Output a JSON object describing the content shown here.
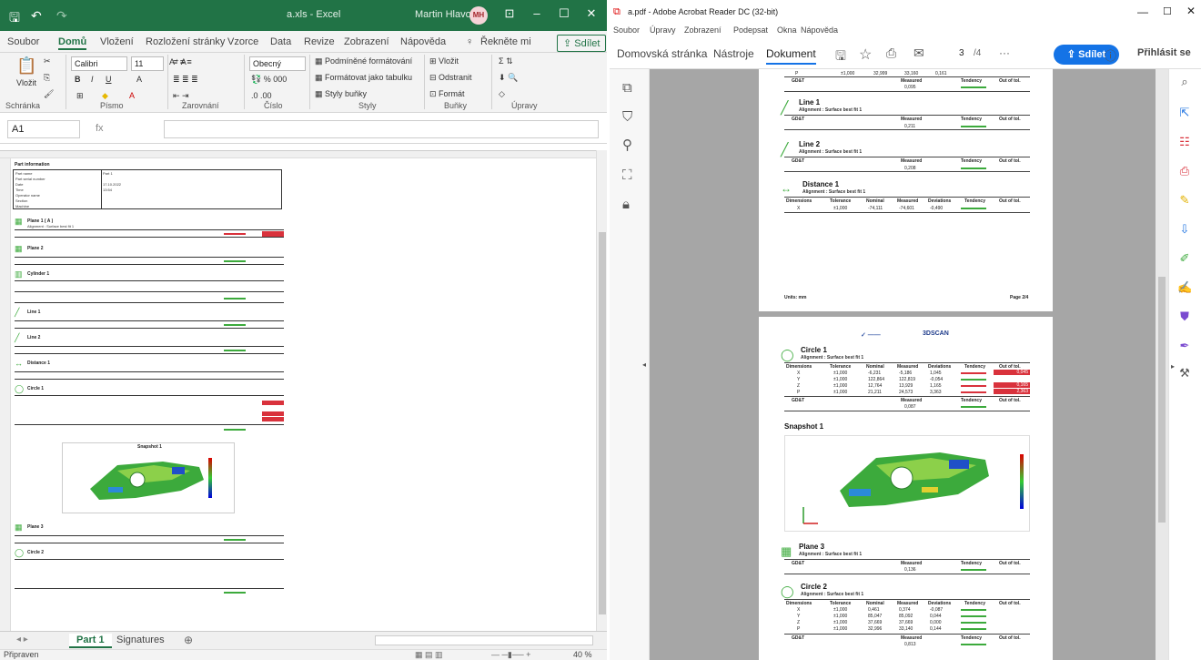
{
  "excel": {
    "file_title": "a.xls - Excel",
    "user_name": "Martin Hlavoň",
    "user_initials": "MH",
    "menu_tabs": [
      "Soubor",
      "Domů",
      "Vložení",
      "Rozložení stránky",
      "Vzorce",
      "Data",
      "Revize",
      "Zobrazení",
      "Nápověda"
    ],
    "tell_me": "Řekněte mi",
    "share": "Sdílet",
    "ribbon": {
      "paste": "Vložit",
      "font_name": "Calibri",
      "font_size": "11",
      "number_format": "Obecný",
      "cond_format": "Podmíněné formátování",
      "format_table": "Formátovat jako tabulku",
      "cell_styles": "Styly buňky",
      "insert": "Vložit",
      "delete": "Odstranit",
      "format": "Formát",
      "groups": [
        "Schránka",
        "Písmo",
        "Zarovnání",
        "Číslo",
        "Styly",
        "Buňky",
        "Úpravy"
      ]
    },
    "name_box": "A1",
    "fx": "fx",
    "sheet_tabs": [
      "Part 1",
      "Signatures"
    ],
    "status": "Připraven",
    "zoom": "40 %",
    "sheet_labels": {
      "part_info": "Part information",
      "rows": [
        "Part name",
        "Part serial number",
        "Date",
        "Time",
        "Operator name",
        "Section",
        "Machine"
      ],
      "part_name_val": "Part 1",
      "date_val": "17.10.2022",
      "time_val": "13:54",
      "features": [
        "Plane 1 ( A )",
        "Plane 2",
        "Cylinder 1",
        "Line 1",
        "Line 2",
        "Distance 1",
        "Circle 1",
        "Plane 3",
        "Circle 2"
      ],
      "snapshot": "Snapshot 1",
      "alignment": "Alignment : Surface best fit 1"
    }
  },
  "pdf": {
    "app_title": "a.pdf - Adobe Acrobat Reader DC (32-bit)",
    "menu": [
      "Soubor",
      "Úpravy",
      "Zobrazení",
      "Podepsat",
      "Okna",
      "Nápověda"
    ],
    "tabs": [
      "Domovská stránka",
      "Nástroje",
      "Dokument"
    ],
    "page_current": "3",
    "page_total": "/4",
    "share": "Sdílet",
    "login": "Přihlásit se",
    "page2": {
      "top_row": [
        "P",
        "±1,000",
        "32,999",
        "33,160",
        "0,161"
      ],
      "gdt_row": [
        "GD&T",
        "Measured",
        "Tendency",
        "Out of tol."
      ],
      "gdt_top_val": "0,095",
      "line1": "Line 1",
      "line1_val": "0,211",
      "line2": "Line 2",
      "line2_val": "0,208",
      "distance1": "Distance 1",
      "alignment": "Alignment : Surface best fit 1",
      "dist_header": [
        "Dimensions",
        "Tolerance",
        "Nominal",
        "Measured",
        "Deviations",
        "Tendency",
        "Out of tol."
      ],
      "dist_row": [
        "X",
        "±1,000",
        "-74,111",
        "-74,601",
        "-0,490"
      ],
      "units": "Units: mm",
      "page_label": "Page 2/4"
    },
    "page3": {
      "logo": "3DSCAN",
      "circle1": "Circle 1",
      "alignment": "Alignment : Surface best fit 1",
      "header": [
        "Dimensions",
        "Tolerance",
        "Nominal",
        "Measured",
        "Deviations",
        "Tendency",
        "Out of tol."
      ],
      "rows": [
        [
          "X",
          "±1,000",
          "-6,231",
          "-5,186",
          "1,045",
          "0,045"
        ],
        [
          "Y",
          "±1,000",
          "122,864",
          "122,819",
          "-0,054",
          ""
        ],
        [
          "Z",
          "±1,000",
          "12,764",
          "13,929",
          "1,165",
          "0,165"
        ],
        [
          "P",
          "±1,000",
          "21,211",
          "24,573",
          "3,363",
          "2,363"
        ]
      ],
      "circle1_gdt": "0,087",
      "snapshot": "Snapshot 1",
      "plane3": "Plane 3",
      "plane3_val": "0,136",
      "circle2": "Circle 2",
      "c2rows": [
        [
          "X",
          "±1,000",
          "0,461",
          "0,374",
          "-0,087"
        ],
        [
          "Y",
          "±1,000",
          "85,047",
          "85,092",
          "0,044"
        ],
        [
          "Z",
          "±1,000",
          "37,669",
          "37,669",
          "0,000"
        ],
        [
          "P",
          "±1,000",
          "32,996",
          "33,140",
          "0,144"
        ]
      ],
      "circle2_gdt": "0,813"
    }
  }
}
